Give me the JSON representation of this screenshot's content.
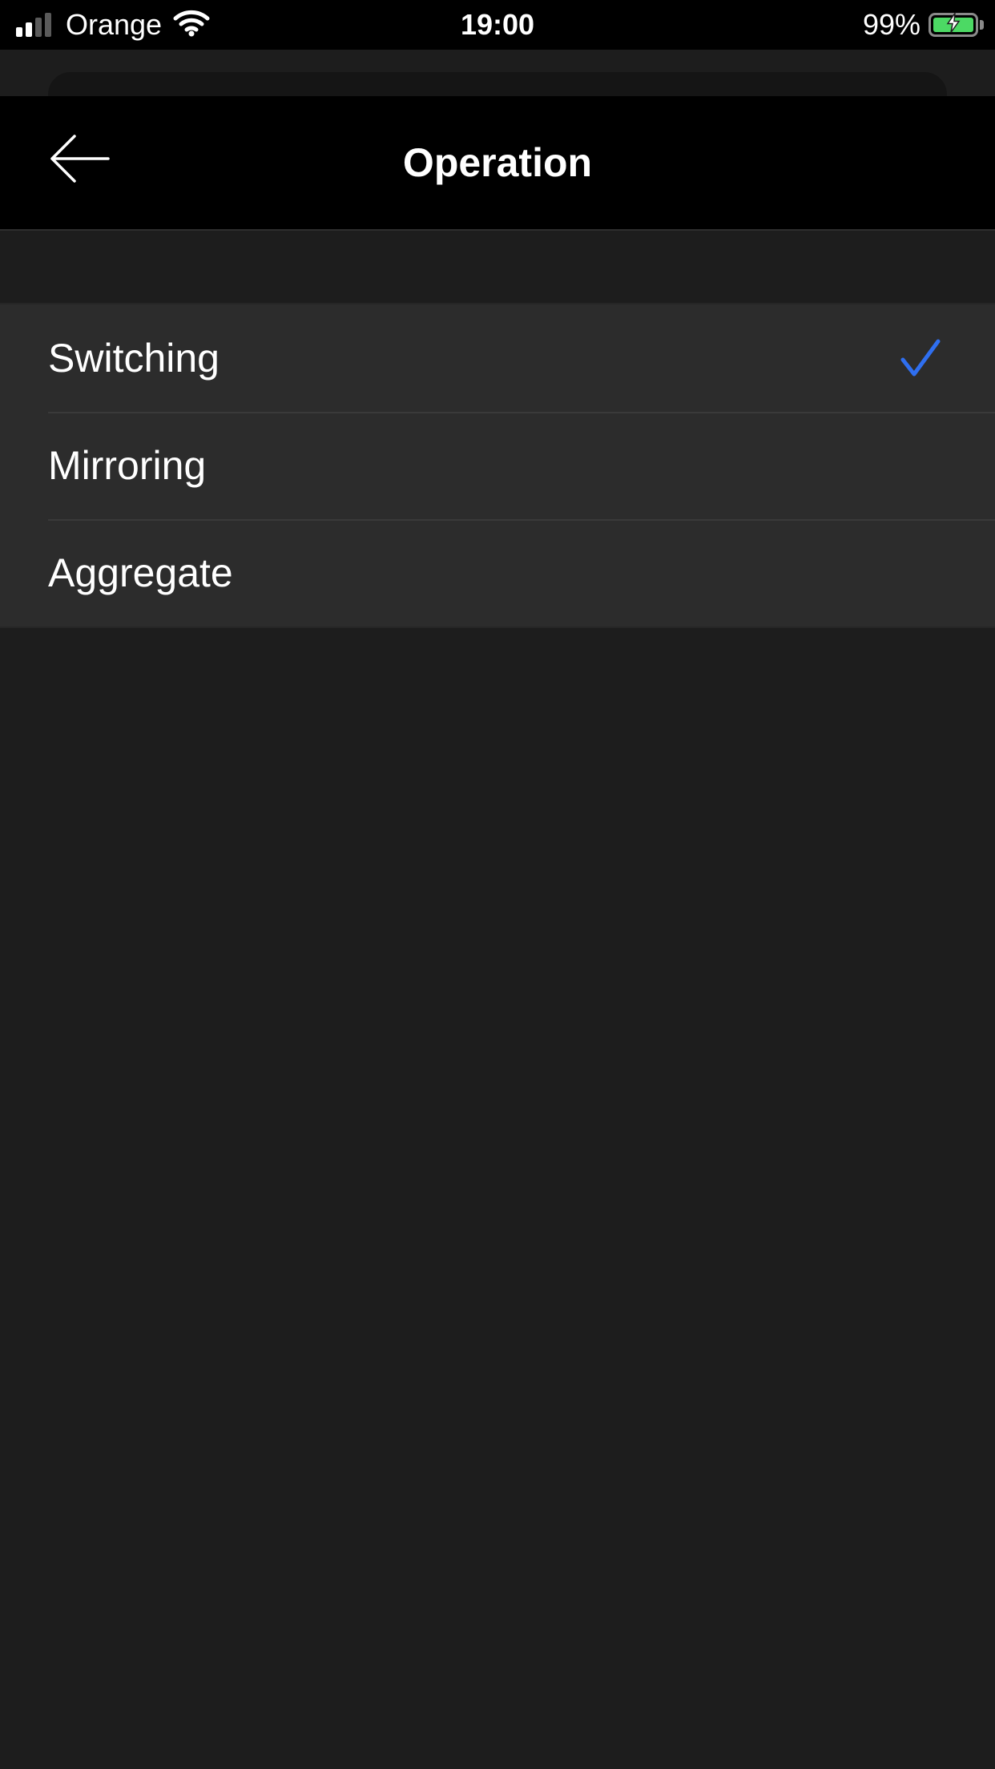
{
  "status_bar": {
    "carrier": "Orange",
    "time": "19:00",
    "battery_percent": "99%",
    "signal_bars_active": 2,
    "signal_bars_total": 4,
    "battery_charging": true,
    "battery_level": 0.99,
    "icons": [
      "signal-icon",
      "wifi-icon",
      "battery-icon",
      "charging-bolt-icon"
    ]
  },
  "nav": {
    "title": "Operation",
    "back_icon": "arrow-left-icon"
  },
  "options": {
    "items": [
      {
        "label": "Switching",
        "selected": true
      },
      {
        "label": "Mirroring",
        "selected": false
      },
      {
        "label": "Aggregate",
        "selected": false
      }
    ],
    "selected_icon": "checkmark-icon"
  },
  "colors": {
    "background": "#1d1d1d",
    "bar_background": "#000000",
    "row_background": "#2c2c2c",
    "accent": "#2f6ff0",
    "text": "#ffffff",
    "battery_fill": "#4cd964"
  }
}
